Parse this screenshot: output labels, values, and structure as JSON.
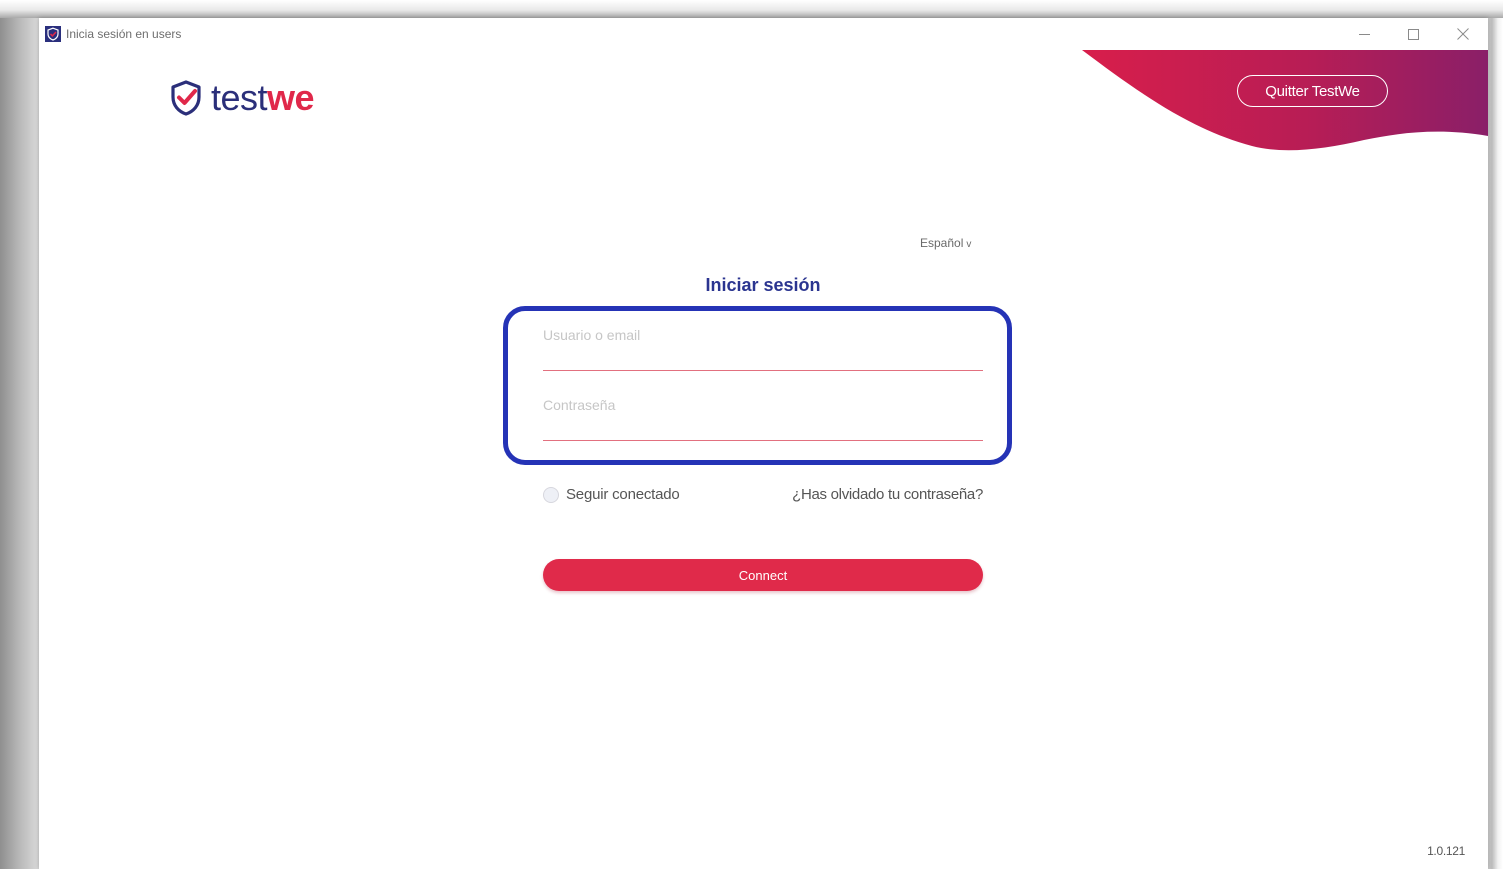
{
  "window": {
    "title": "Inicia sesión en users",
    "controls": {
      "minimize_icon": "minimize-icon",
      "maximize_icon": "maximize-icon",
      "close_icon": "close-icon"
    }
  },
  "brand": {
    "logo_prefix": "test",
    "logo_suffix": "we",
    "logo_icon": "shield-check-icon",
    "primary_color": "#2b2f7a",
    "accent_color": "#e0284a",
    "wave_gradient": [
      "#d81e4b",
      "#8a1f68"
    ]
  },
  "header": {
    "quit_label": "Quitter TestWe"
  },
  "language": {
    "selected": "Español",
    "chevron": "v"
  },
  "login": {
    "title": "Iniciar sesión",
    "username": {
      "value": "",
      "placeholder": "Usuario o email"
    },
    "password": {
      "value": "",
      "placeholder": "Contraseña"
    },
    "remember_label": "Seguir conectado",
    "remember_checked": false,
    "forgot_label": "¿Has olvidado tu contraseña?",
    "connect_label": "Connect"
  },
  "footer": {
    "version": "1.0.121"
  },
  "annotation": {
    "highlight_color": "#2533b6"
  }
}
